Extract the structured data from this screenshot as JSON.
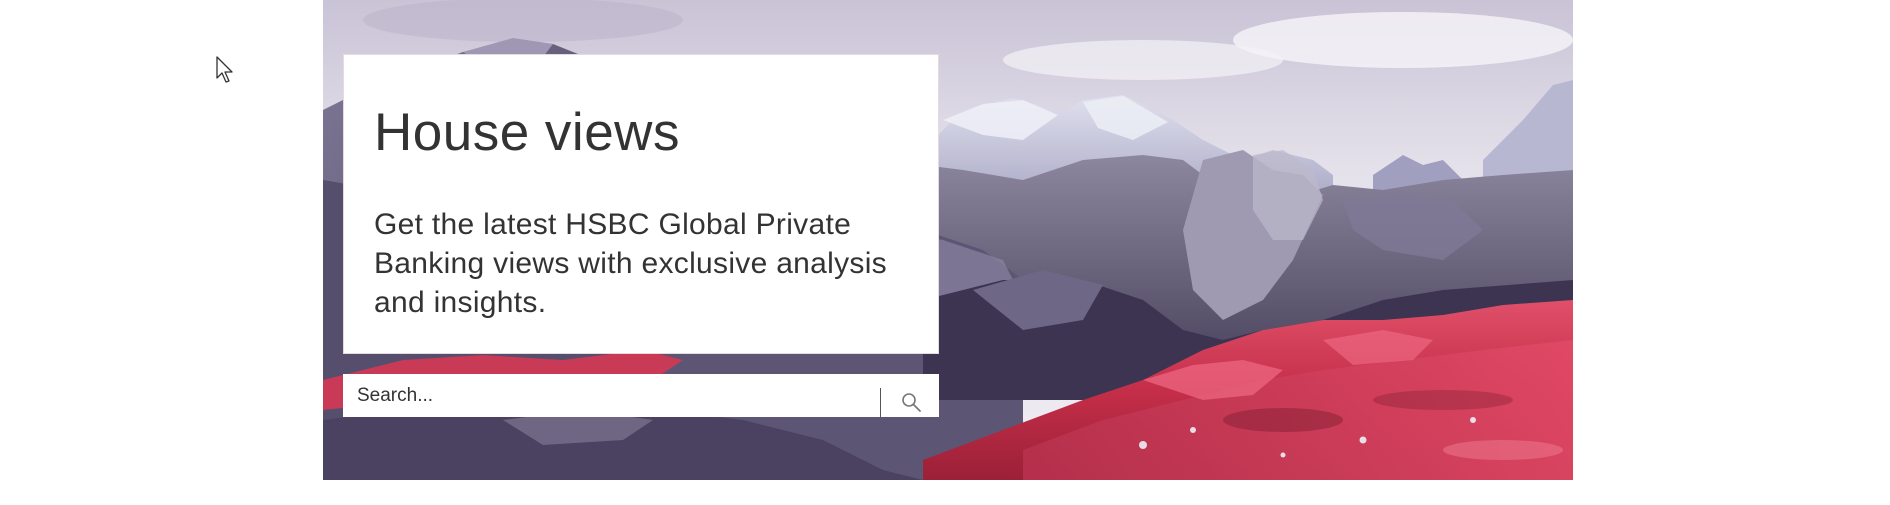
{
  "hero": {
    "image": "mountain-landscape"
  },
  "card": {
    "title": "House views",
    "description": "Get the latest HSBC Global Private Banking views with exclusive analysis and insights."
  },
  "search": {
    "placeholder": "Search...",
    "icon": "search-icon"
  },
  "colors": {
    "text": "#333333",
    "card_bg": "#ffffff",
    "sky": "#d8d4e2",
    "rock": "#6f6a86",
    "heather": "#d0344e"
  }
}
